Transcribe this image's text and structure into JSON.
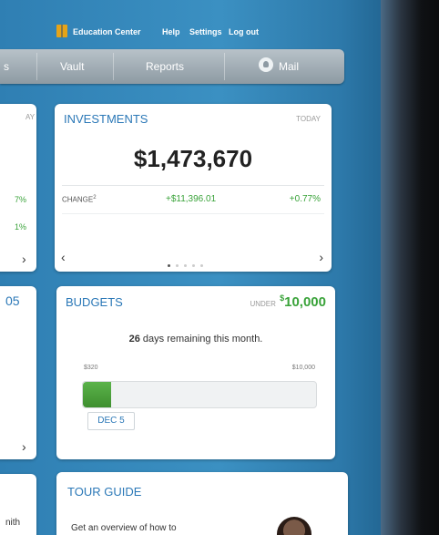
{
  "topbar": {
    "education_center": "Education Center",
    "help": "Help",
    "settings": "Settings",
    "logout": "Log out"
  },
  "navbar": {
    "partial_left": "s",
    "vault": "Vault",
    "reports": "Reports",
    "mail": "Mail"
  },
  "left_cards": {
    "top_today_partial": "AY",
    "pct1": "7%",
    "pct2": "1%",
    "middle_partial_number": "05",
    "bottom_partial_text": "nith"
  },
  "investments": {
    "title": "INVESTMENTS",
    "today": "TODAY",
    "total": "$1,473,670",
    "change_label": "CHANGE",
    "change_superscript": "2",
    "change_amount": "+$11,396.01",
    "change_percent": "+0.77%",
    "page_dots": 5,
    "active_dot": 0
  },
  "budgets": {
    "title": "BUDGETS",
    "under_label": "UNDER",
    "under_symbol": "$",
    "under_amount": "10,000",
    "days_number": "26",
    "days_text": " days remaining this month.",
    "spent_label": "$320",
    "limit_label": "$10,000",
    "progress_fraction": 0.12,
    "date": "DEC 5"
  },
  "tour_guide": {
    "title": "TOUR GUIDE",
    "text": "Get an overview of how to"
  },
  "colors": {
    "accent_blue": "#2b78b7",
    "positive_green": "#3aa33a",
    "background_blue": "#3b90c2"
  }
}
